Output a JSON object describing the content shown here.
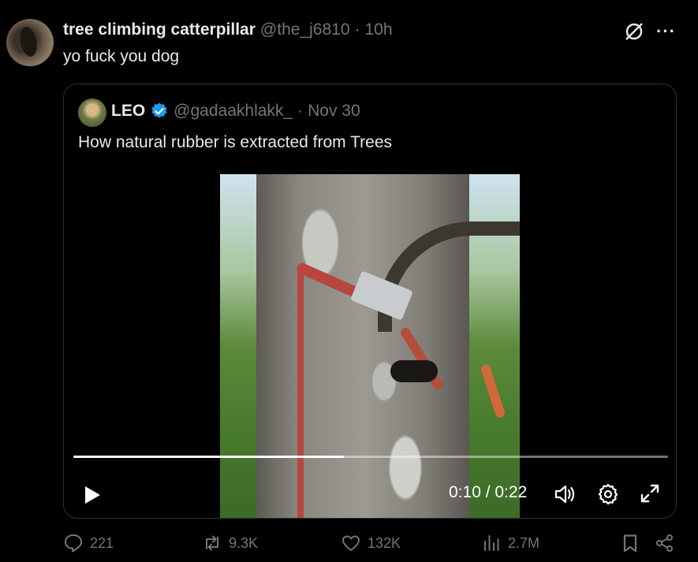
{
  "tweet": {
    "display_name": "tree climbing catterpillar",
    "handle": "@the_j6810",
    "separator": "·",
    "time": "10h",
    "text": "yo fuck you dog",
    "more_label": "···"
  },
  "quoted": {
    "display_name": "LEO",
    "handle": "@gadaakhlakk_",
    "separator": "·",
    "date": "Nov 30",
    "text": "How natural rubber is extracted from Trees",
    "verified_color": "#1d9bf0"
  },
  "video": {
    "current_time": "0:10",
    "duration": "0:22",
    "time_display": "0:10 / 0:22",
    "progress_fraction": 0.4545
  },
  "actions": {
    "replies": "221",
    "reposts": "9.3K",
    "likes": "132K",
    "views": "2.7M"
  },
  "colors": {
    "background": "#000000",
    "text_primary": "#e7e9ea",
    "text_secondary": "#71767b",
    "border": "#2f3336"
  }
}
